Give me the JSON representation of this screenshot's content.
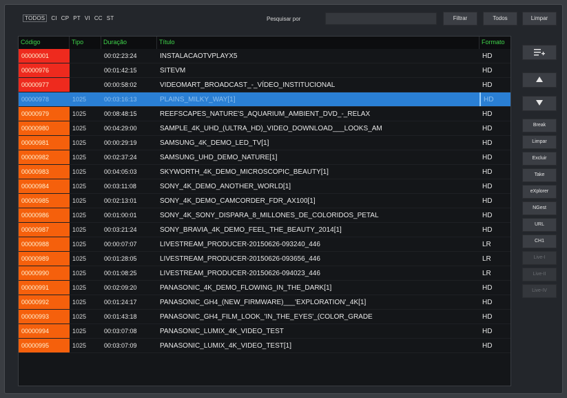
{
  "toolbar": {
    "filters": [
      "TODOS",
      "CI",
      "CP",
      "PT",
      "VI",
      "CC",
      "ST"
    ],
    "active_filter": "TODOS",
    "search_label": "Pesquisar por",
    "search_value": "",
    "filter_button": "Filtrar",
    "all_button": "Todos",
    "clear_button": "Limpar"
  },
  "table": {
    "columns": [
      "Código",
      "Tipo",
      "Duração",
      "Título",
      "Formato"
    ],
    "selected_code": "00000978",
    "rows": [
      {
        "code": "00000001",
        "tipo": "",
        "dur": "00:02:23:24",
        "title": "INSTALACAOTVPLAYX5",
        "fmt": "HD",
        "codeColor": "#ee2a1e"
      },
      {
        "code": "00000976",
        "tipo": "",
        "dur": "00:01:42:15",
        "title": "SITEVM",
        "fmt": "HD",
        "codeColor": "#ee2a1e"
      },
      {
        "code": "00000977",
        "tipo": "",
        "dur": "00:00:58:02",
        "title": "VIDEOMART_BROADCAST_-_VÍDEO_INSTITUCIONAL",
        "fmt": "HD",
        "codeColor": "#ee2a1e"
      },
      {
        "code": "00000978",
        "tipo": "1025",
        "dur": "00:03:16:13",
        "title": "PLAINS_MILKY_WAY[1]",
        "fmt": "HD",
        "codeColor": "#2a7fd4"
      },
      {
        "code": "00000979",
        "tipo": "1025",
        "dur": "00:08:48:15",
        "title": "REEFSCAPES_NATURE'S_AQUARIUM_AMBIENT_DVD_-_RELAX",
        "fmt": "HD",
        "codeColor": "#f5600c"
      },
      {
        "code": "00000980",
        "tipo": "1025",
        "dur": "00:04:29:00",
        "title": "SAMPLE_4K_UHD_(ULTRA_HD)_VIDEO_DOWNLOAD___LOOKS_AM",
        "fmt": "HD",
        "codeColor": "#f5600c"
      },
      {
        "code": "00000981",
        "tipo": "1025",
        "dur": "00:00:29:19",
        "title": "SAMSUNG_4K_DEMO_LED_TV[1]",
        "fmt": "HD",
        "codeColor": "#f5600c"
      },
      {
        "code": "00000982",
        "tipo": "1025",
        "dur": "00:02:37:24",
        "title": "SAMSUNG_UHD_DEMO_NATURE[1]",
        "fmt": "HD",
        "codeColor": "#f5600c"
      },
      {
        "code": "00000983",
        "tipo": "1025",
        "dur": "00:04:05:03",
        "title": "SKYWORTH_4K_DEMO_MICROSCOPIC_BEAUTY[1]",
        "fmt": "HD",
        "codeColor": "#f5600c"
      },
      {
        "code": "00000984",
        "tipo": "1025",
        "dur": "00:03:11:08",
        "title": "SONY_4K_DEMO_ANOTHER_WORLD[1]",
        "fmt": "HD",
        "codeColor": "#f5600c"
      },
      {
        "code": "00000985",
        "tipo": "1025",
        "dur": "00:02:13:01",
        "title": "SONY_4K_DEMO_CAMCORDER_FDR_AX100[1]",
        "fmt": "HD",
        "codeColor": "#f5600c"
      },
      {
        "code": "00000986",
        "tipo": "1025",
        "dur": "00:01:00:01",
        "title": "SONY_4K_SONY_DISPARA_8_MILLONES_DE_COLORIDOS_PETAL",
        "fmt": "HD",
        "codeColor": "#f5600c"
      },
      {
        "code": "00000987",
        "tipo": "1025",
        "dur": "00:03:21:24",
        "title": "SONY_BRAVIA_4K_DEMO_FEEL_THE_BEAUTY_2014[1]",
        "fmt": "HD",
        "codeColor": "#f5600c"
      },
      {
        "code": "00000988",
        "tipo": "1025",
        "dur": "00:00:07:07",
        "title": "LIVESTREAM_PRODUCER-20150626-093240_446",
        "fmt": "LR",
        "codeColor": "#f5600c"
      },
      {
        "code": "00000989",
        "tipo": "1025",
        "dur": "00:01:28:05",
        "title": "LIVESTREAM_PRODUCER-20150626-093656_446",
        "fmt": "LR",
        "codeColor": "#f5600c"
      },
      {
        "code": "00000990",
        "tipo": "1025",
        "dur": "00:01:08:25",
        "title": "LIVESTREAM_PRODUCER-20150626-094023_446",
        "fmt": "LR",
        "codeColor": "#f5600c"
      },
      {
        "code": "00000991",
        "tipo": "1025",
        "dur": "00:02:09:20",
        "title": "PANASONIC_4K_DEMO_FLOWING_IN_THE_DARK[1]",
        "fmt": "HD",
        "codeColor": "#f5600c"
      },
      {
        "code": "00000992",
        "tipo": "1025",
        "dur": "00:01:24:17",
        "title": "PANASONIC_GH4_(NEW_FIRMWARE)___'EXPLORATION'_4K[1]",
        "fmt": "HD",
        "codeColor": "#f5600c"
      },
      {
        "code": "00000993",
        "tipo": "1025",
        "dur": "00:01:43:18",
        "title": "PANASONIC_GH4_FILM_LOOK_'IN_THE_EYES'_(COLOR_GRADE",
        "fmt": "HD",
        "codeColor": "#f5600c"
      },
      {
        "code": "00000994",
        "tipo": "1025",
        "dur": "00:03:07:08",
        "title": "PANASONIC_LUMIX_4K_VIDEO_TEST",
        "fmt": "HD",
        "codeColor": "#f5600c"
      },
      {
        "code": "00000995",
        "tipo": "1025",
        "dur": "00:03:07:09",
        "title": "PANASONIC_LUMIX_4K_VIDEO_TEST[1]",
        "fmt": "HD",
        "codeColor": "#f5600c"
      }
    ]
  },
  "side_buttons": {
    "add_icon": "playlist-add-icon",
    "up_icon": "arrow-up-icon",
    "down_icon": "arrow-down-icon",
    "break": "Break",
    "clear": "Limpar",
    "delete": "Excluir",
    "take": "Take",
    "explorer": "eXplorer",
    "ingest": "NGest",
    "url": "URL",
    "ch1": "CH1",
    "live1": "Live-I",
    "live2": "Live-II",
    "live4": "Live-IV"
  }
}
